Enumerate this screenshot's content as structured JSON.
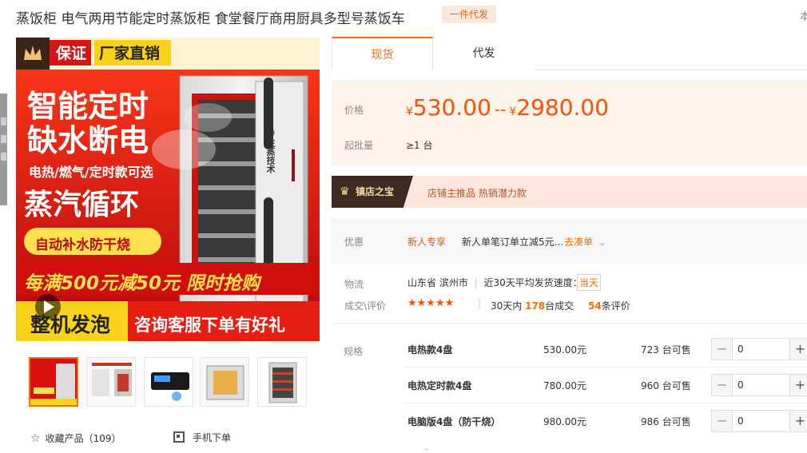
{
  "header": {
    "title": "蒸饭柜 电气两用节能定时蒸饭柜 食堂餐厅商用厨具多型号蒸饭车",
    "tag": "一件代发",
    "edge_char": "本"
  },
  "main_image": {
    "badge_guarantee": "保证",
    "badge_factory": "厂家直销",
    "headline_1": "智能定时",
    "headline_2": "缺水断电",
    "sub_1": "电热/燃气/定时款可选",
    "sub_2": "蒸汽循环",
    "sub_3": "自动补水防干烧",
    "promo": "每满500元减50元 限时抢购",
    "bottom_left": "整机发泡",
    "bottom_right": "咨询客服下单有好礼",
    "door_text": "专注蒸技术"
  },
  "thumbnails": [
    "thumb-1",
    "thumb-2",
    "thumb-3",
    "thumb-4",
    "thumb-5"
  ],
  "actions": {
    "favorite": "收藏产品（109）",
    "mobile_order": "手机下单"
  },
  "tabs": [
    {
      "label": "现货",
      "active": true
    },
    {
      "label": "代发",
      "active": false
    }
  ],
  "price": {
    "label": "价格",
    "currency": "¥",
    "low": "530.00",
    "separator": "--",
    "high": "2980.00",
    "moq_label": "起批量",
    "moq_value": "≥1 台"
  },
  "treasure": {
    "badge": "镇店之宝",
    "text": "店铺主推品  热销潜力款"
  },
  "promo": {
    "label": "优惠",
    "tag": "新人专享",
    "text": "新人单笔订单立减5元...",
    "link": "去凑单"
  },
  "logistics": {
    "label": "物流",
    "location": "山东省 滨州市",
    "speed_text": "近30天平均发货速度：",
    "speed_badge": "当天"
  },
  "rating": {
    "label": "成交\\评价",
    "stars": "★★★★★",
    "deals_prefix": "30天内",
    "deals_count": "178",
    "deals_suffix": "台成交",
    "reviews_count": "54",
    "reviews_suffix": "条评价"
  },
  "specs": {
    "label": "规格",
    "rows": [
      {
        "name": "电热款4盘",
        "price": "530.00元",
        "stock": "723 台可售",
        "qty": "0"
      },
      {
        "name": "电热定时款4盘",
        "price": "780.00元",
        "stock": "960 台可售",
        "qty": "0"
      },
      {
        "name": "电脑版4盘（防干烧）",
        "price": "980.00元",
        "stock": "986 台可售",
        "qty": "0"
      }
    ]
  }
}
